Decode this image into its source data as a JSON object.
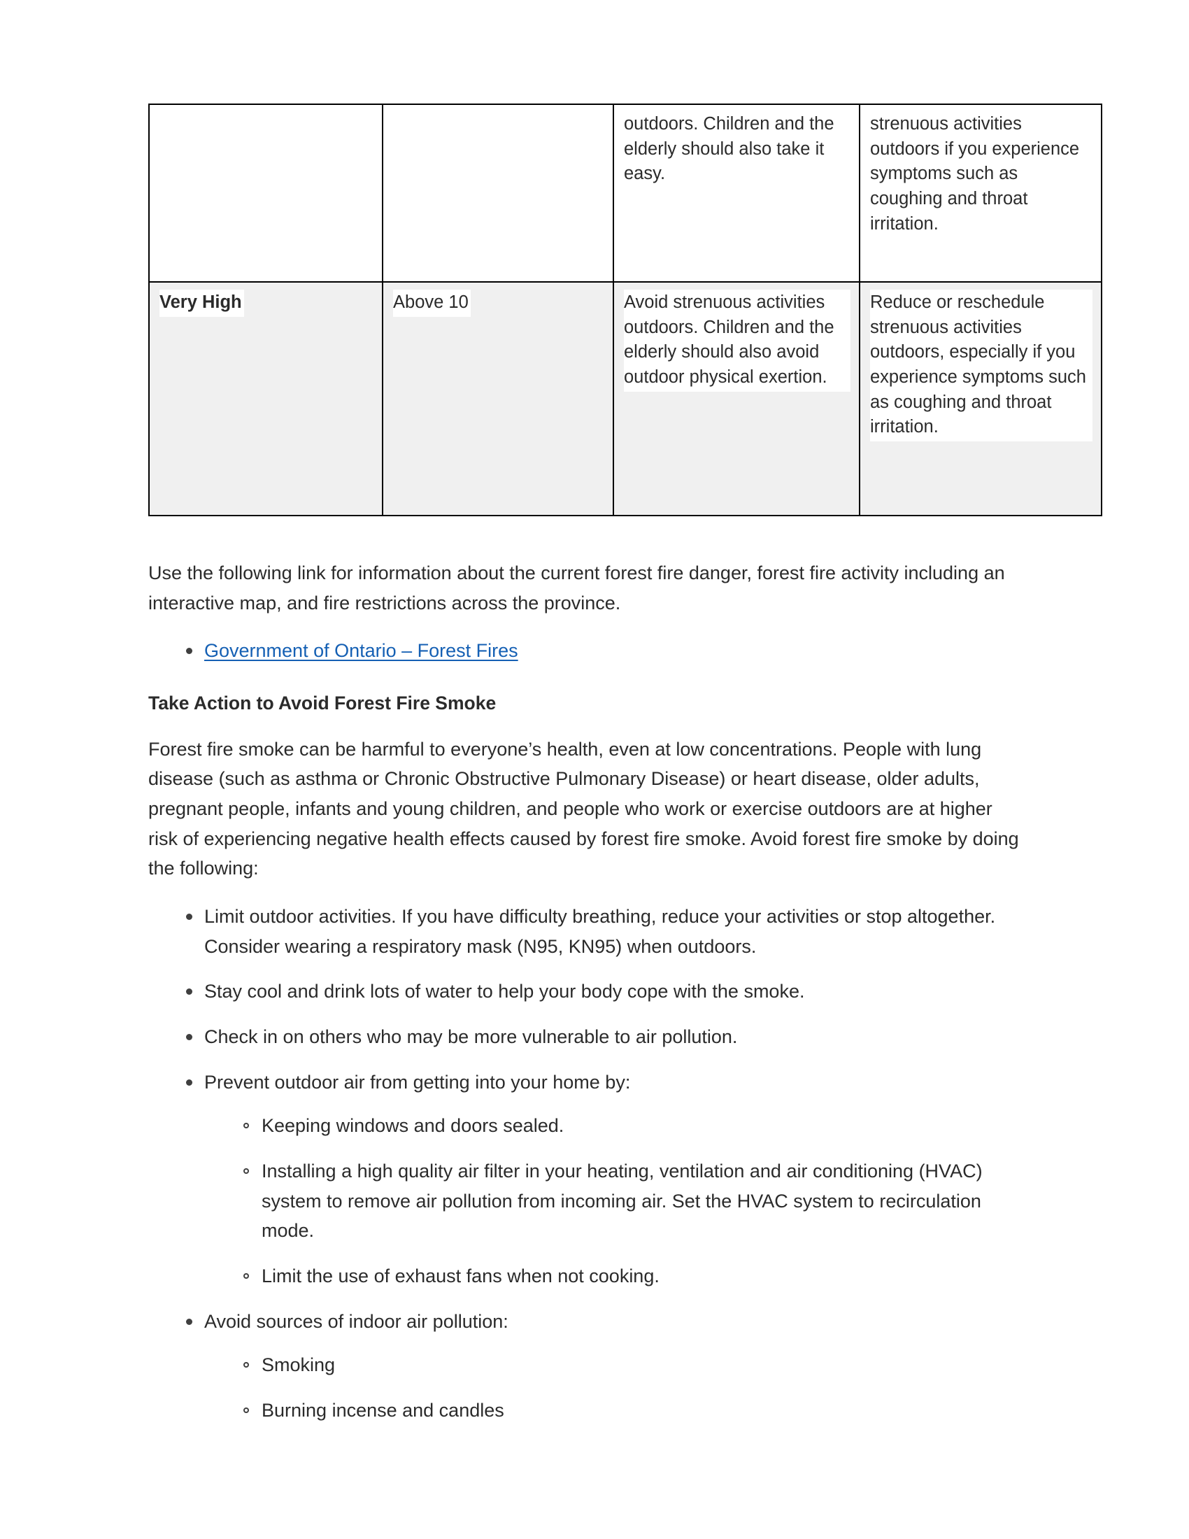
{
  "table": {
    "columns": 4,
    "rows": [
      {
        "id": "continued-row",
        "continued": true,
        "shaded": false,
        "cells": [
          "",
          "",
          "outdoors. Children and the elderly should also take it easy.",
          "strenuous activities outdoors if you experience symptoms such as coughing and throat irritation."
        ]
      },
      {
        "id": "very-high-row",
        "continued": false,
        "shaded": true,
        "cells": [
          "Very High",
          "Above 10",
          "Avoid strenuous activities outdoors. Children and the elderly should also avoid outdoor physical exertion.",
          "Reduce or reschedule strenuous activities outdoors, especially if you experience symptoms such as coughing and throat irritation."
        ]
      }
    ]
  },
  "body": {
    "intro_paragraph": "Use the following link for information about the current forest fire danger, forest fire activity including an interactive map, and fire restrictions across the province.",
    "link": {
      "label": "Government of Ontario – Forest Fires",
      "color": "#1560b4"
    },
    "heading": "Take Action to Avoid Forest Fire Smoke",
    "smoke_paragraph": "Forest fire smoke can be harmful to everyone’s health, even at low concentrations. People with lung disease (such as asthma or Chronic Obstructive Pulmonary Disease) or heart disease, older adults, pregnant people, infants and young children, and people who work or exercise outdoors are at higher risk of experiencing negative health effects caused by forest fire smoke. Avoid forest fire smoke by doing the following:",
    "actions": [
      {
        "text": "Limit outdoor activities. If you have difficulty breathing, reduce your activities or stop altogether. Consider wearing a respiratory mask (N95, KN95) when outdoors.",
        "subitems": []
      },
      {
        "text": "Stay cool and drink lots of water to help your body cope with the smoke.",
        "subitems": []
      },
      {
        "text": "Check in on others who may be more vulnerable to air pollution.",
        "subitems": []
      },
      {
        "text": "Prevent outdoor air from getting into your home by:",
        "subitems": [
          "Keeping windows and doors sealed.",
          "Installing a high quality air filter in your heating, ventilation and air conditioning (HVAC) system to remove air pollution from incoming air. Set the HVAC system to recirculation mode.",
          "Limit the use of exhaust fans when not cooking."
        ]
      },
      {
        "text": "Avoid sources of indoor air pollution:",
        "subitems": [
          "Smoking",
          "Burning incense and candles"
        ]
      }
    ]
  },
  "colors": {
    "text": "#2b2b2b",
    "link": "#1560b4",
    "table_border": "#000000",
    "row_shade": "#f0f0f0",
    "page_background": "#ffffff"
  }
}
